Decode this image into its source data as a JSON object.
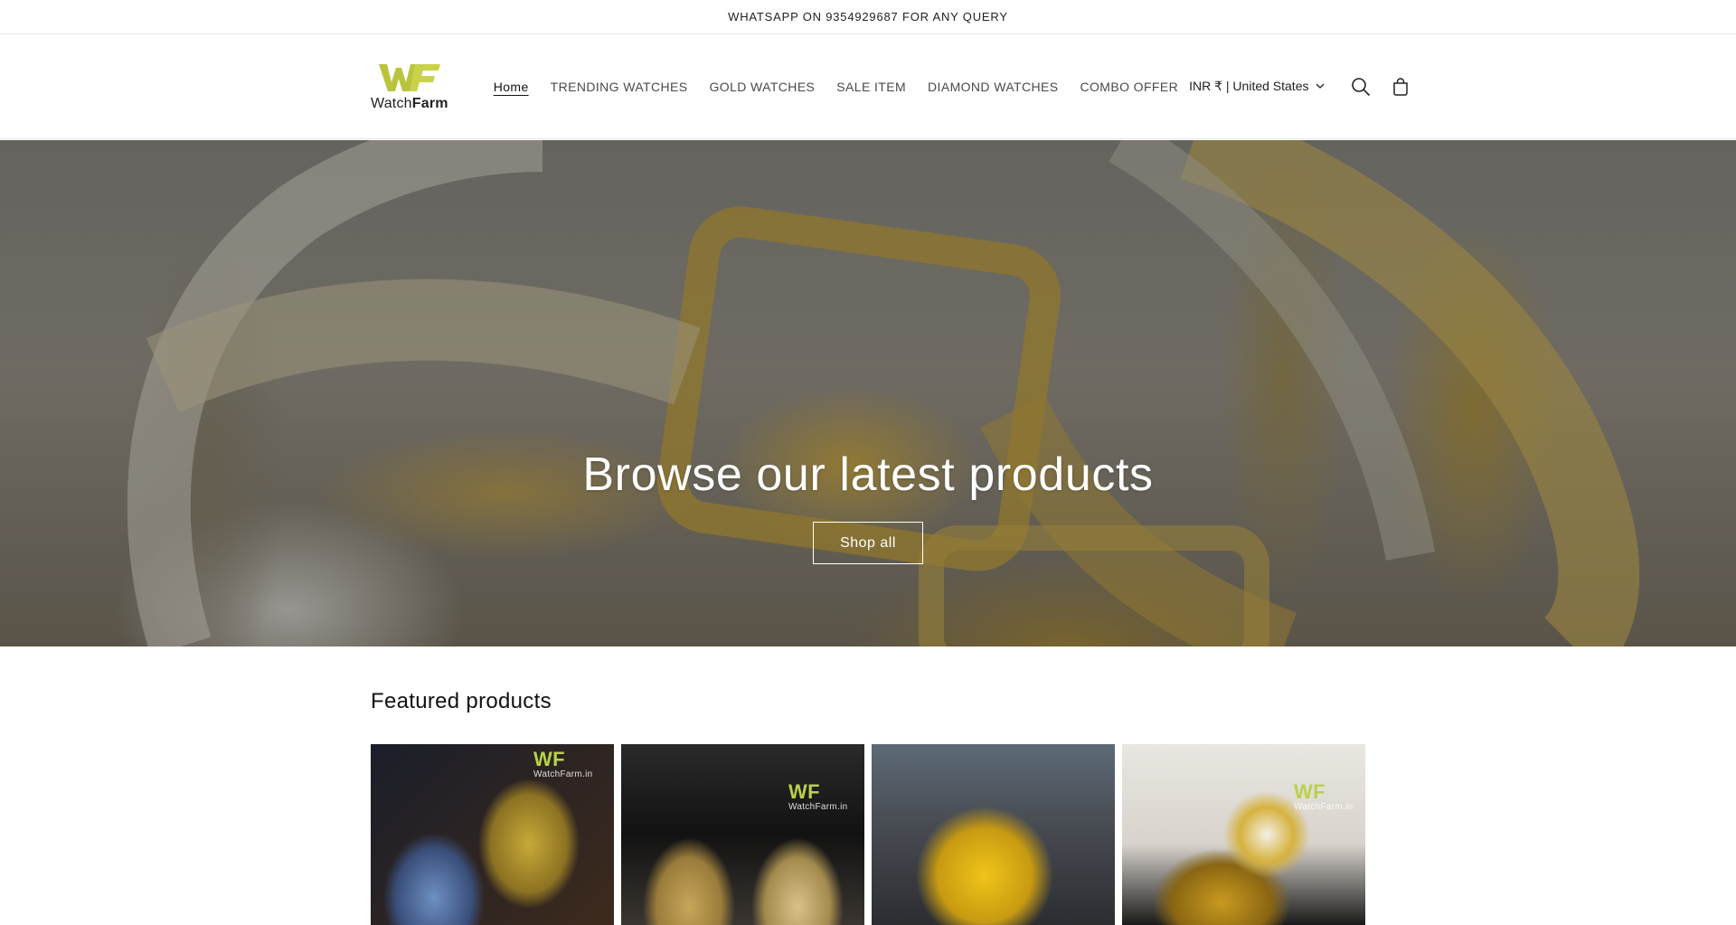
{
  "announcement": {
    "text": "WHATSAPP ON 9354929687 FOR ANY QUERY"
  },
  "header": {
    "logo": {
      "mark": "WF",
      "text_light": "Watch",
      "text_bold": "Farm"
    },
    "nav": [
      {
        "label": "Home",
        "active": true
      },
      {
        "label": "TRENDING WATCHES",
        "active": false
      },
      {
        "label": "GOLD WATCHES",
        "active": false
      },
      {
        "label": "SALE ITEM",
        "active": false
      },
      {
        "label": "DIAMOND WATCHES",
        "active": false
      },
      {
        "label": "COMBO OFFER",
        "active": false
      }
    ],
    "locale": "INR ₹ | United States",
    "icons": {
      "search": "search-icon",
      "cart": "cart-icon",
      "chevron": "chevron-down-icon"
    }
  },
  "hero": {
    "title": "Browse our latest products",
    "button": "Shop all"
  },
  "featured": {
    "title": "Featured products",
    "cards": [
      {
        "watermark_mark": "WF",
        "watermark_text": "WatchFarm.in"
      },
      {
        "watermark_mark": "WF",
        "watermark_text": "WatchFarm.in"
      },
      {
        "watermark_mark": "",
        "watermark_text": ""
      },
      {
        "watermark_mark": "WF",
        "watermark_text": "WatchFarm.in"
      }
    ]
  },
  "colors": {
    "brand_green": "#b9d14a",
    "text": "#121212",
    "border": "#e6e6e6"
  }
}
